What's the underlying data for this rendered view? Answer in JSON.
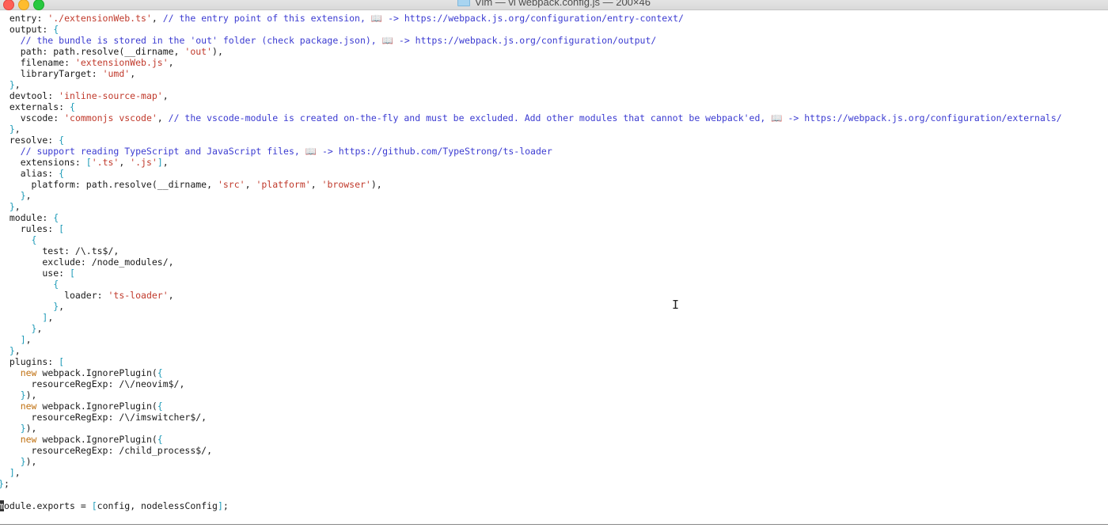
{
  "window": {
    "title": "Vim — vi webpack.config.js — 200×46",
    "colors": {
      "string": "#c0392b",
      "comment": "#3b3bd1",
      "bracket": "#1e9bb8",
      "keyword_new": "#c07010"
    }
  },
  "editor": {
    "lines": [
      [
        [
          "k",
          "  entry: "
        ],
        [
          "s",
          "'./extensionWeb.ts'"
        ],
        [
          "k",
          ", "
        ],
        [
          "c",
          "// the entry point of this extension, 📖 -> https://webpack.js.org/configuration/entry-context/"
        ]
      ],
      [
        [
          "k",
          "  output: "
        ],
        [
          "b",
          "{"
        ]
      ],
      [
        [
          "c",
          "    // the bundle is stored in the 'out' folder (check package.json), 📖 -> https://webpack.js.org/configuration/output/"
        ]
      ],
      [
        [
          "k",
          "    path: path.resolve(__dirname, "
        ],
        [
          "s",
          "'out'"
        ],
        [
          "k",
          "),"
        ]
      ],
      [
        [
          "k",
          "    filename: "
        ],
        [
          "s",
          "'extensionWeb.js'"
        ],
        [
          "k",
          ","
        ]
      ],
      [
        [
          "k",
          "    libraryTarget: "
        ],
        [
          "s",
          "'umd'"
        ],
        [
          "k",
          ","
        ]
      ],
      [
        [
          "b",
          "  }"
        ],
        [
          "k",
          ","
        ]
      ],
      [
        [
          "k",
          "  devtool: "
        ],
        [
          "s",
          "'inline-source-map'"
        ],
        [
          "k",
          ","
        ]
      ],
      [
        [
          "k",
          "  externals: "
        ],
        [
          "b",
          "{"
        ]
      ],
      [
        [
          "k",
          "    vscode: "
        ],
        [
          "s",
          "'commonjs vscode'"
        ],
        [
          "k",
          ", "
        ],
        [
          "c",
          "// the vscode-module is created on-the-fly and must be excluded. Add other modules that cannot be webpack'ed, 📖 -> https://webpack.js.org/configuration/externals/"
        ]
      ],
      [
        [
          "b",
          "  }"
        ],
        [
          "k",
          ","
        ]
      ],
      [
        [
          "k",
          "  resolve: "
        ],
        [
          "b",
          "{"
        ]
      ],
      [
        [
          "c",
          "    // support reading TypeScript and JavaScript files, 📖 -> https://github.com/TypeStrong/ts-loader"
        ]
      ],
      [
        [
          "k",
          "    extensions: "
        ],
        [
          "b",
          "["
        ],
        [
          "s",
          "'.ts'"
        ],
        [
          "k",
          ", "
        ],
        [
          "s",
          "'.js'"
        ],
        [
          "b",
          "]"
        ],
        [
          "k",
          ","
        ]
      ],
      [
        [
          "k",
          "    alias: "
        ],
        [
          "b",
          "{"
        ]
      ],
      [
        [
          "k",
          "      platform: path.resolve(__dirname, "
        ],
        [
          "s",
          "'src'"
        ],
        [
          "k",
          ", "
        ],
        [
          "s",
          "'platform'"
        ],
        [
          "k",
          ", "
        ],
        [
          "s",
          "'browser'"
        ],
        [
          "k",
          "),"
        ]
      ],
      [
        [
          "b",
          "    }"
        ],
        [
          "k",
          ","
        ]
      ],
      [
        [
          "b",
          "  }"
        ],
        [
          "k",
          ","
        ]
      ],
      [
        [
          "k",
          "  module: "
        ],
        [
          "b",
          "{"
        ]
      ],
      [
        [
          "k",
          "    rules: "
        ],
        [
          "b",
          "["
        ]
      ],
      [
        [
          "b",
          "      {"
        ]
      ],
      [
        [
          "k",
          "        test: /\\.ts$/,"
        ]
      ],
      [
        [
          "k",
          "        exclude: /node_modules/,"
        ]
      ],
      [
        [
          "k",
          "        use: "
        ],
        [
          "b",
          "["
        ]
      ],
      [
        [
          "b",
          "          {"
        ]
      ],
      [
        [
          "k",
          "            loader: "
        ],
        [
          "s",
          "'ts-loader'"
        ],
        [
          "k",
          ","
        ]
      ],
      [
        [
          "b",
          "          }"
        ],
        [
          "k",
          ","
        ]
      ],
      [
        [
          "b",
          "        ]"
        ],
        [
          "k",
          ","
        ]
      ],
      [
        [
          "b",
          "      }"
        ],
        [
          "k",
          ","
        ]
      ],
      [
        [
          "b",
          "    ]"
        ],
        [
          "k",
          ","
        ]
      ],
      [
        [
          "b",
          "  }"
        ],
        [
          "k",
          ","
        ]
      ],
      [
        [
          "k",
          "  plugins: "
        ],
        [
          "b",
          "["
        ]
      ],
      [
        [
          "o",
          "    new"
        ],
        [
          "k",
          " webpack.IgnorePlugin("
        ],
        [
          "b",
          "{"
        ]
      ],
      [
        [
          "k",
          "      resourceRegExp: /\\/neovim$/,"
        ]
      ],
      [
        [
          "b",
          "    }"
        ],
        [
          "k",
          "),"
        ]
      ],
      [
        [
          "o",
          "    new"
        ],
        [
          "k",
          " webpack.IgnorePlugin("
        ],
        [
          "b",
          "{"
        ]
      ],
      [
        [
          "k",
          "      resourceRegExp: /\\/imswitcher$/,"
        ]
      ],
      [
        [
          "b",
          "    }"
        ],
        [
          "k",
          "),"
        ]
      ],
      [
        [
          "o",
          "    new"
        ],
        [
          "k",
          " webpack.IgnorePlugin("
        ],
        [
          "b",
          "{"
        ]
      ],
      [
        [
          "k",
          "      resourceRegExp: /child_process$/,"
        ]
      ],
      [
        [
          "b",
          "    }"
        ],
        [
          "k",
          "),"
        ]
      ],
      [
        [
          "b",
          "  ]"
        ],
        [
          "k",
          ","
        ]
      ],
      [
        [
          "b",
          "}"
        ],
        [
          "k",
          ";"
        ]
      ],
      [
        [
          "k",
          ""
        ]
      ],
      [
        [
          "cur",
          "m"
        ],
        [
          "k",
          "odule.exports = "
        ],
        [
          "b",
          "["
        ],
        [
          "k",
          "config, nodelessConfig"
        ],
        [
          "b",
          "]"
        ],
        [
          "k",
          ";"
        ]
      ]
    ]
  }
}
